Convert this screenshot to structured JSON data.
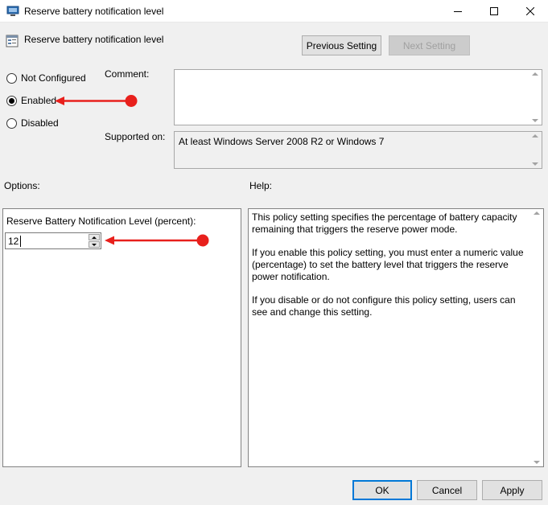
{
  "window": {
    "title": "Reserve battery notification level",
    "controls": [
      "minimize-icon",
      "maximize-icon",
      "close-icon"
    ]
  },
  "header": {
    "setting_name": "Reserve battery notification level",
    "prev_button": "Previous Setting",
    "next_button": "Next Setting"
  },
  "state": {
    "options": [
      "Not Configured",
      "Enabled",
      "Disabled"
    ],
    "selected": "Enabled"
  },
  "comment": {
    "label": "Comment:",
    "value": ""
  },
  "supported": {
    "label": "Supported on:",
    "value": "At least Windows Server 2008 R2 or Windows 7"
  },
  "options_panel": {
    "label": "Options:",
    "field_label": "Reserve Battery Notification Level (percent):",
    "field_value": "12"
  },
  "help_panel": {
    "label": "Help:",
    "paragraphs": [
      "This policy setting specifies the percentage of battery capacity remaining that triggers the reserve power mode.",
      "If you enable this policy setting, you must enter a numeric value (percentage) to set the battery level that triggers the reserve power notification.",
      "If you disable or do not configure this policy setting, users can see and change this setting."
    ]
  },
  "footer": {
    "ok": "OK",
    "cancel": "Cancel",
    "apply": "Apply"
  },
  "colors": {
    "annotation_arrow": "#e8201c",
    "accent": "#0078d7"
  }
}
